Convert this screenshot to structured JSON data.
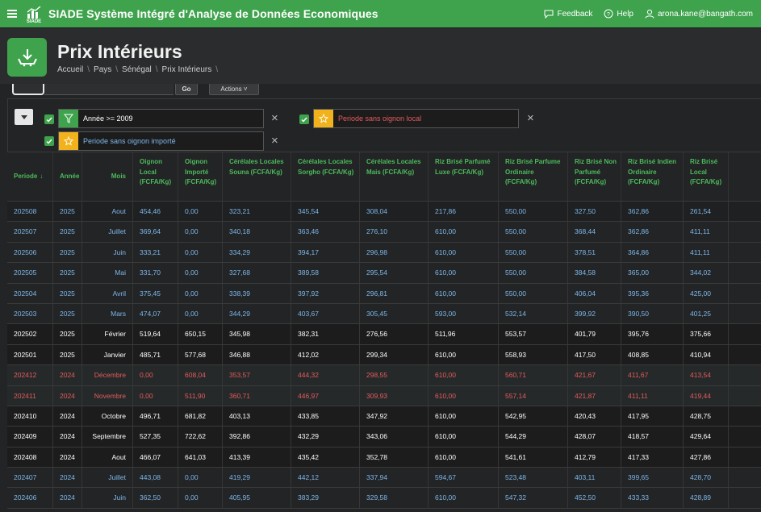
{
  "topbar": {
    "logo_text": "SIADE",
    "app_title": "SIADE Système Intégré d'Analyse de Données Economiques",
    "feedback": "Feedback",
    "help": "Help",
    "user": "arona.kane@bangath.com",
    "icons": [
      "menu-icon",
      "feedback-icon",
      "help-icon",
      "user-icon"
    ]
  },
  "header": {
    "title": "Prix Intérieurs",
    "breadcrumb": [
      "Accueil",
      "Pays",
      "Sénégal",
      "Prix Intérieurs"
    ],
    "page_icon": "download-tray-icon"
  },
  "toolbar": {
    "go_label": "Go",
    "actions_label": "Actions ˅"
  },
  "filters": [
    {
      "label": "Année >= 2009",
      "type": "filter",
      "checked": true,
      "text_color": "#ffffff"
    },
    {
      "label": "Periode sans oignon local",
      "type": "highlight",
      "checked": true,
      "text_color": "#e35b5b"
    },
    {
      "label": "Periode sans oignon importé",
      "type": "highlight",
      "checked": true,
      "text_color": "#7db7ea"
    }
  ],
  "table": {
    "columns": [
      "Periode",
      "Année",
      "Mois",
      "Oignon Local (FCFA/Kg)",
      "Oignon Importé (FCFA/Kg)",
      "Cérélales Locales Souna (FCFA/Kg)",
      "Cérélales Locales Sorgho (FCFA/Kg)",
      "Cérélales Locales Mais (FCFA/Kg)",
      "Riz Brisé Parfumé Luxe (FCFA/Kg)",
      "Riz Brisé Parfume Ordinaire (FCFA/Kg)",
      "Riz Brisé Non Parfumé (FCFA/Kg)",
      "Riz Brisé Indien Ordinaire (FCFA/Kg)",
      "Riz Brisé Local (FCFA/Kg)"
    ],
    "sort_indicator": "↓",
    "rows": [
      {
        "style": "blue",
        "cells": [
          "202508",
          "2025",
          "Aout",
          "454,46",
          "0,00",
          "323,21",
          "345,54",
          "308,04",
          "217,86",
          "550,00",
          "327,50",
          "362,86",
          "261,54"
        ]
      },
      {
        "style": "blue",
        "cells": [
          "202507",
          "2025",
          "Juillet",
          "369,64",
          "0,00",
          "340,18",
          "363,46",
          "276,10",
          "610,00",
          "550,00",
          "368,44",
          "362,86",
          "411,11"
        ]
      },
      {
        "style": "blue",
        "cells": [
          "202506",
          "2025",
          "Juin",
          "333,21",
          "0,00",
          "334,29",
          "394,17",
          "296,98",
          "610,00",
          "550,00",
          "378,51",
          "364,86",
          "411,11"
        ]
      },
      {
        "style": "blue",
        "cells": [
          "202505",
          "2025",
          "Mai",
          "331,70",
          "0,00",
          "327,68",
          "389,58",
          "295,54",
          "610,00",
          "550,00",
          "384,58",
          "365,00",
          "344,02"
        ]
      },
      {
        "style": "blue",
        "cells": [
          "202504",
          "2025",
          "Avril",
          "375,45",
          "0,00",
          "338,39",
          "397,92",
          "296,81",
          "610,00",
          "550,00",
          "406,04",
          "395,36",
          "425,00"
        ]
      },
      {
        "style": "blue",
        "cells": [
          "202503",
          "2025",
          "Mars",
          "474,07",
          "0,00",
          "344,29",
          "403,67",
          "305,45",
          "593,00",
          "532,14",
          "399,92",
          "390,50",
          "401,25"
        ]
      },
      {
        "style": "white",
        "cells": [
          "202502",
          "2025",
          "Février",
          "519,64",
          "650,15",
          "345,98",
          "382,31",
          "276,56",
          "511,96",
          "553,57",
          "401,79",
          "395,76",
          "375,66"
        ]
      },
      {
        "style": "white",
        "cells": [
          "202501",
          "2025",
          "Janvier",
          "485,71",
          "577,68",
          "346,88",
          "412,02",
          "299,34",
          "610,00",
          "558,93",
          "417,50",
          "408,85",
          "410,94"
        ]
      },
      {
        "style": "red",
        "cells": [
          "202412",
          "2024",
          "Décembre",
          "0,00",
          "608,04",
          "353,57",
          "444,32",
          "298,55",
          "610,00",
          "560,71",
          "421,67",
          "411,67",
          "413,54"
        ]
      },
      {
        "style": "red",
        "cells": [
          "202411",
          "2024",
          "Novembre",
          "0,00",
          "511,90",
          "360,71",
          "446,97",
          "309,93",
          "610,00",
          "557,14",
          "421,87",
          "411,11",
          "419,44"
        ]
      },
      {
        "style": "white",
        "cells": [
          "202410",
          "2024",
          "Octobre",
          "496,71",
          "681,82",
          "403,13",
          "433,85",
          "347,92",
          "610,00",
          "542,95",
          "420,43",
          "417,95",
          "428,75"
        ]
      },
      {
        "style": "white",
        "cells": [
          "202409",
          "2024",
          "Septembre",
          "527,35",
          "722,62",
          "392,86",
          "432,29",
          "343,06",
          "610,00",
          "544,29",
          "428,07",
          "418,57",
          "429,64"
        ]
      },
      {
        "style": "white",
        "cells": [
          "202408",
          "2024",
          "Aout",
          "466,07",
          "641,03",
          "413,39",
          "435,42",
          "352,78",
          "610,00",
          "541,61",
          "412,79",
          "417,33",
          "427,86"
        ]
      },
      {
        "style": "blue",
        "cells": [
          "202407",
          "2024",
          "Juillet",
          "443,08",
          "0,00",
          "419,29",
          "442,12",
          "337,94",
          "594,67",
          "523,48",
          "403,11",
          "399,65",
          "428,70"
        ]
      },
      {
        "style": "blue",
        "cells": [
          "202406",
          "2024",
          "Juin",
          "362,50",
          "0,00",
          "405,95",
          "383,29",
          "329,58",
          "610,00",
          "547,32",
          "452,50",
          "433,33",
          "428,89"
        ]
      }
    ]
  }
}
